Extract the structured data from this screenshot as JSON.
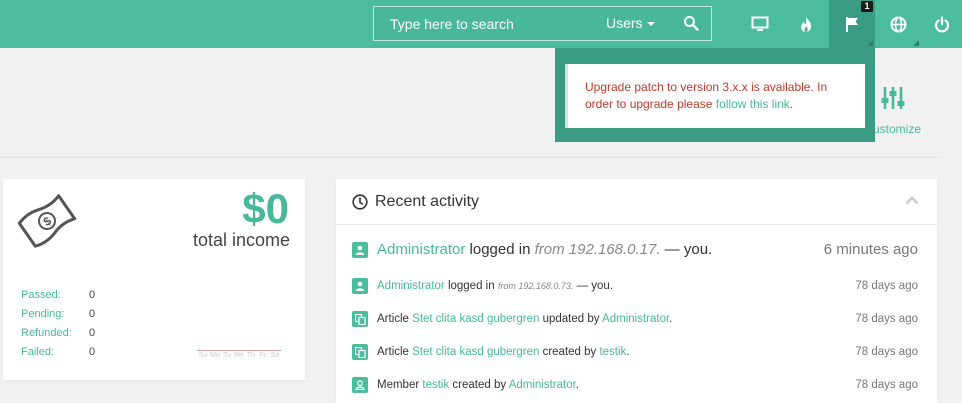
{
  "search": {
    "placeholder": "Type here to search",
    "scope": "Users"
  },
  "notifications": {
    "badge": "1",
    "message_prefix": "Upgrade patch to version 3.x.x is available. In order to upgrade please ",
    "link": "follow this link",
    "message_suffix": "."
  },
  "customize": {
    "label": "ustomize"
  },
  "income": {
    "amount": "$0",
    "label": "total income",
    "stats": [
      {
        "label": "Passed:",
        "value": "0"
      },
      {
        "label": "Pending:",
        "value": "0"
      },
      {
        "label": "Refunded:",
        "value": "0"
      },
      {
        "label": "Failed:",
        "value": "0"
      }
    ],
    "weekdays": [
      "Su",
      "Mo",
      "Tu",
      "We",
      "Th",
      "Fr",
      "Sa"
    ]
  },
  "activity": {
    "title": "Recent activity",
    "items": [
      {
        "actor": "Administrator",
        "action": " logged in ",
        "from": "from 192.168.0.17.",
        "suffix": " — you.",
        "time": "6 minutes ago",
        "icon": "user-icon"
      },
      {
        "actor": "Administrator",
        "action": " logged in ",
        "from": "from 192.168.0.73.",
        "suffix": " — you.",
        "time": "78 days ago",
        "icon": "user-icon"
      },
      {
        "pre": "Article ",
        "link1": "Stet clita kasd gubergren",
        "mid": " updated by ",
        "link2": "Administrator",
        "post": ".",
        "time": "78 days ago",
        "icon": "article-icon"
      },
      {
        "pre": "Article ",
        "link1": "Stet clita kasd gubergren",
        "mid": " created by ",
        "link2": "testik",
        "post": ".",
        "time": "78 days ago",
        "icon": "article-icon"
      },
      {
        "pre": "Member ",
        "link1": "testik",
        "mid": " created by ",
        "link2": "Administrator",
        "post": ".",
        "time": "78 days ago",
        "icon": "member-icon"
      }
    ]
  },
  "colors": {
    "brand": "#4cbc9f",
    "brand_dark": "#3a9c84",
    "alert_text": "#c0392b"
  }
}
